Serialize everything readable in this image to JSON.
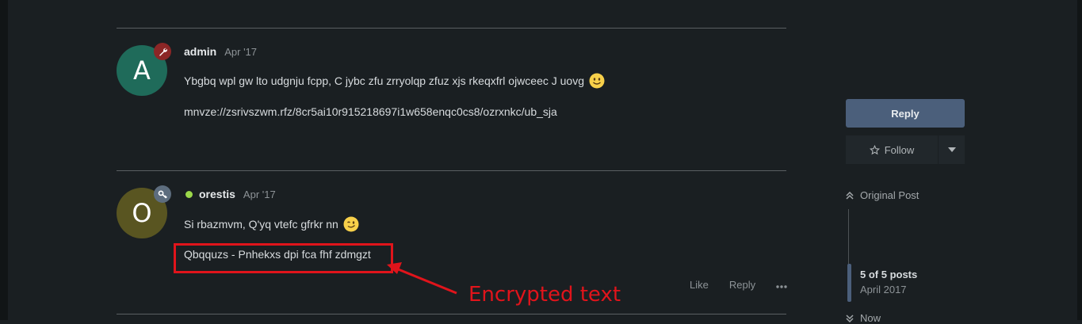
{
  "posts": [
    {
      "avatar_letter": "A",
      "avatar_color": "#1f6b5a",
      "flair_icon": "wrench-icon",
      "flair_color": "#8c2626",
      "username": "admin",
      "date": "Apr '17",
      "lines": [
        "Ybgbq wpl gw lto udgnju fcpp, C jybc zfu zrryolqp zfuz xjs rkeqxfrl ojwceec J uovg",
        "mnvze://zsrivszwm.rfz/8cr5ai10r915218697i1w658enqc0cs8/ozrxnkc/ub_sja"
      ]
    },
    {
      "avatar_letter": "O",
      "avatar_color": "#595521",
      "flair_icon": "key-icon",
      "flair_color": "#5d6d7e",
      "online": true,
      "username": "orestis",
      "date": "Apr '17",
      "lines": [
        "Si rbazmvm, Q'yq vtefc gfrkr nn",
        "Qbqquzs - Pnhekxs dpi fca fhf zdmgzt"
      ],
      "actions": {
        "like": "Like",
        "reply": "Reply"
      }
    }
  ],
  "annotation": {
    "label": "Encrypted text",
    "color": "#e0141b"
  },
  "sidebar": {
    "reply_label": "Reply",
    "follow_label": "Follow",
    "original_post": "Original Post",
    "position": "5 of 5 posts",
    "position_date": "April 2017",
    "now_label": "Now"
  }
}
